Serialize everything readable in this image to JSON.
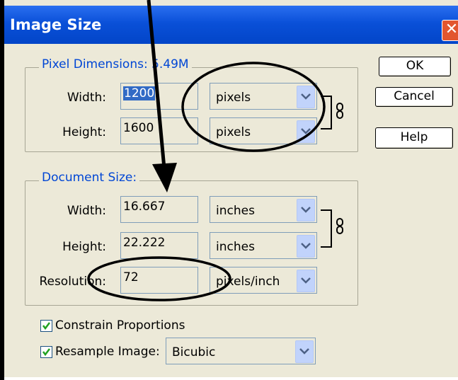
{
  "dialog": {
    "title": "Image Size",
    "close_glyph": "✕"
  },
  "pixel_dimensions": {
    "legend": "Pixel Dimensions:  5.49M",
    "width_label": "Width:",
    "width_value": "1200",
    "width_unit": "pixels",
    "height_label": "Height:",
    "height_value": "1600",
    "height_unit": "pixels"
  },
  "document_size": {
    "legend": "Document Size:",
    "width_label": "Width:",
    "width_value": "16.667",
    "width_unit": "inches",
    "height_label": "Height:",
    "height_value": "22.222",
    "height_unit": "inches",
    "resolution_label": "Resolution:",
    "resolution_value": "72",
    "resolution_unit": "pixels/inch"
  },
  "buttons": {
    "ok": "OK",
    "cancel": "Cancel",
    "help": "Help"
  },
  "options": {
    "constrain_label": "Constrain Proportions",
    "constrain_checked": true,
    "resample_label": "Resample Image:",
    "resample_checked": true,
    "resample_method": "Bicubic"
  },
  "icons": {
    "chain": "chain-link-icon",
    "dropdown": "chevron-down-icon",
    "check": "checkmark-icon"
  },
  "colors": {
    "titlebar": "#0a50d8",
    "legend_text": "#0046d5",
    "dialog_bg": "#ece9d8",
    "close_button": "#e2562f"
  }
}
